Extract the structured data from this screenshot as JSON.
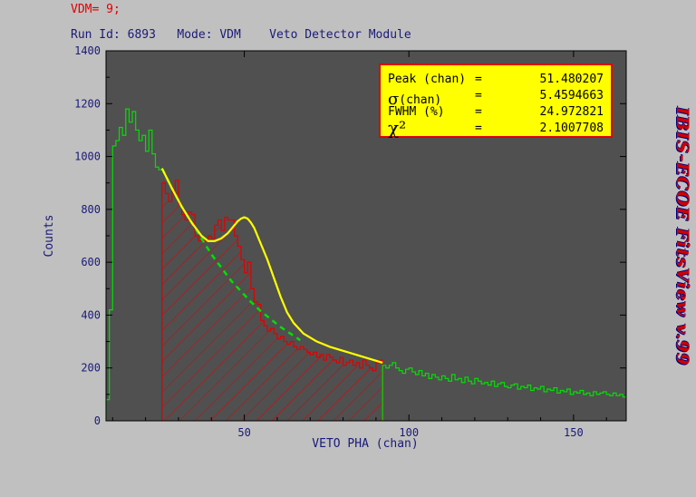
{
  "header": {
    "vdm_label": "VDM= 9;",
    "run_info": "Run Id: 6893   Mode: VDM    Veto Detector Module"
  },
  "side_label": "IBIS-ECOE  FitsView v.99",
  "fit_box": {
    "rows": [
      {
        "label": "Peak (chan)",
        "eq": "=",
        "value": "51.480207"
      },
      {
        "label": "σ",
        "label_suffix": "(chan)",
        "eq": "=",
        "value": "5.4594663"
      },
      {
        "label": "FWHM (%)",
        "eq": "=",
        "value": "24.972821"
      },
      {
        "label": "χ²",
        "eq": "=",
        "value": "2.1007708"
      }
    ]
  },
  "colors": {
    "plot_bg": "#505050",
    "histogram": "#00e000",
    "fit_region_hatch": "#e00000",
    "fit_curve": "#ffff00",
    "background_curve": "#00e000",
    "axis_text": "#1a1a7a"
  },
  "chart_data": {
    "type": "line",
    "xlabel": "VETO PHA (chan)",
    "ylabel": "Counts",
    "xlim": [
      8,
      166
    ],
    "ylim": [
      0,
      1400
    ],
    "x_ticks": [
      50,
      100,
      150
    ],
    "y_ticks": [
      0,
      200,
      400,
      600,
      800,
      1000,
      1200,
      1400
    ],
    "grid": false,
    "fit_region": [
      25,
      92
    ],
    "histogram": {
      "x": [
        8,
        9,
        10,
        11,
        12,
        13,
        14,
        15,
        16,
        17,
        18,
        19,
        20,
        21,
        22,
        23,
        24,
        25,
        26,
        27,
        28,
        29,
        30,
        31,
        32,
        33,
        34,
        35,
        36,
        37,
        38,
        39,
        40,
        41,
        42,
        43,
        44,
        45,
        46,
        47,
        48,
        49,
        50,
        51,
        52,
        53,
        54,
        55,
        56,
        57,
        58,
        59,
        60,
        61,
        62,
        63,
        64,
        65,
        66,
        67,
        68,
        69,
        70,
        71,
        72,
        73,
        74,
        75,
        76,
        77,
        78,
        79,
        80,
        81,
        82,
        83,
        84,
        85,
        86,
        87,
        88,
        89,
        90,
        91,
        92,
        93,
        94,
        95,
        96,
        97,
        98,
        99,
        100,
        101,
        102,
        103,
        104,
        105,
        106,
        107,
        108,
        109,
        110,
        111,
        112,
        113,
        114,
        115,
        116,
        117,
        118,
        119,
        120,
        121,
        122,
        123,
        124,
        125,
        126,
        127,
        128,
        129,
        130,
        131,
        132,
        133,
        134,
        135,
        136,
        137,
        138,
        139,
        140,
        141,
        142,
        143,
        144,
        145,
        146,
        147,
        148,
        149,
        150,
        151,
        152,
        153,
        154,
        155,
        156,
        157,
        158,
        159,
        160,
        161,
        162,
        163,
        164,
        165
      ],
      "y": [
        80,
        420,
        1040,
        1060,
        1110,
        1080,
        1180,
        1130,
        1170,
        1100,
        1060,
        1080,
        1020,
        1100,
        1010,
        960,
        950,
        900,
        860,
        830,
        870,
        910,
        820,
        780,
        760,
        790,
        780,
        700,
        680,
        690,
        680,
        700,
        690,
        740,
        760,
        720,
        770,
        760,
        760,
        700,
        660,
        610,
        560,
        600,
        500,
        450,
        440,
        380,
        360,
        340,
        350,
        330,
        310,
        320,
        300,
        290,
        300,
        280,
        270,
        280,
        270,
        260,
        250,
        260,
        240,
        250,
        230,
        250,
        240,
        230,
        220,
        240,
        210,
        220,
        230,
        210,
        220,
        200,
        230,
        210,
        200,
        190,
        220,
        230,
        210,
        200,
        210,
        220,
        200,
        190,
        180,
        195,
        200,
        185,
        175,
        190,
        170,
        180,
        160,
        175,
        165,
        155,
        170,
        160,
        150,
        175,
        155,
        160,
        145,
        165,
        150,
        140,
        160,
        150,
        140,
        145,
        135,
        150,
        130,
        140,
        145,
        130,
        125,
        135,
        140,
        120,
        130,
        125,
        135,
        115,
        125,
        120,
        130,
        110,
        120,
        115,
        125,
        105,
        115,
        110,
        120,
        100,
        110,
        105,
        115,
        100,
        105,
        95,
        110,
        100,
        105,
        110,
        100,
        95,
        105,
        95,
        100,
        90,
        95,
        90,
        85,
        95,
        90,
        85,
        90,
        85,
        90,
        85,
        80,
        85,
        80,
        75,
        80
      ]
    },
    "fit_curve": {
      "x": [
        25,
        28,
        31,
        34,
        37,
        39,
        41,
        43,
        45,
        47,
        48,
        49,
        50,
        51,
        52,
        53,
        54,
        55,
        57,
        59,
        61,
        63,
        65,
        68,
        72,
        76,
        80,
        84,
        88,
        92
      ],
      "y": [
        955,
        880,
        810,
        750,
        700,
        680,
        680,
        690,
        710,
        740,
        755,
        765,
        770,
        765,
        750,
        730,
        700,
        670,
        610,
        540,
        470,
        410,
        370,
        330,
        300,
        280,
        265,
        250,
        235,
        220
      ]
    },
    "background_curve": {
      "x": [
        25,
        28,
        31,
        34,
        37,
        40,
        43,
        46,
        49,
        52,
        55,
        58,
        61,
        64,
        67
      ],
      "y": [
        955,
        880,
        810,
        750,
        690,
        630,
        580,
        530,
        490,
        450,
        415,
        385,
        355,
        330,
        305
      ]
    }
  }
}
